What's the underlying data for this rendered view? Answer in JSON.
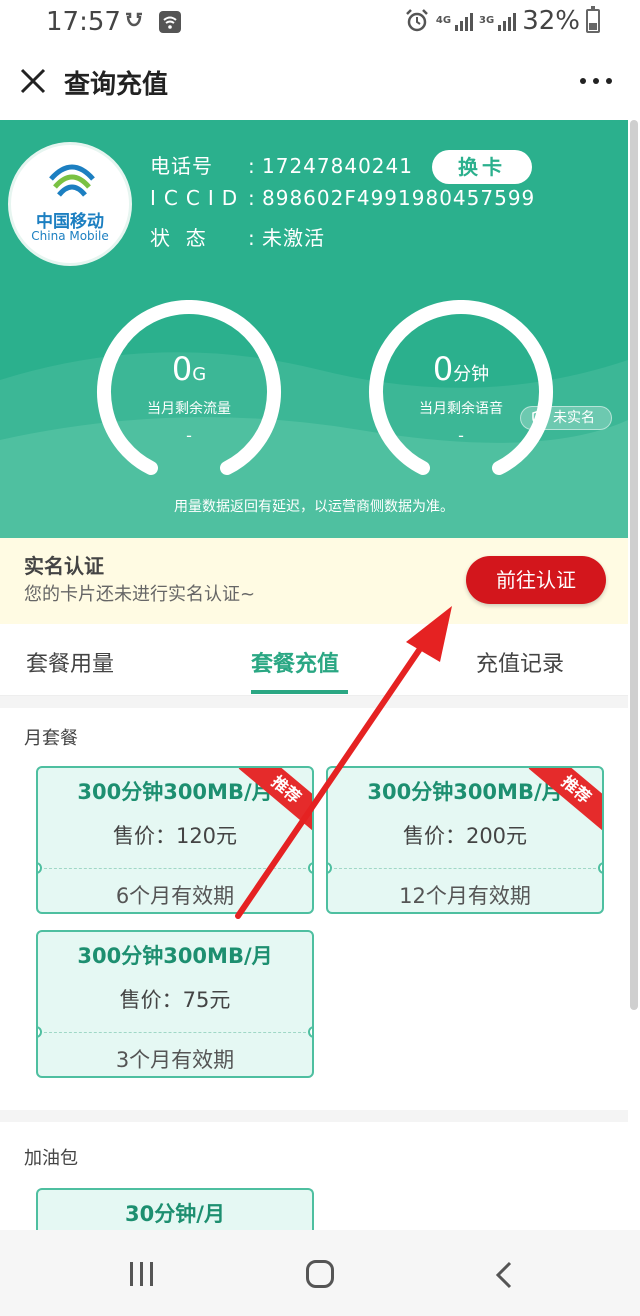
{
  "status_bar": {
    "time": "17:57",
    "battery": "32%",
    "net_4g": "4G",
    "net_3g": "3G",
    "icons": [
      "alarm-icon",
      "signal-icon",
      "battery-icon"
    ]
  },
  "title_bar": {
    "title": "查询充值",
    "close_icon": "close-icon",
    "more_icon": "more-icon"
  },
  "header": {
    "logo_cn": "中国移动",
    "logo_en": "China Mobile",
    "phone_label": "电话号",
    "phone_value": "17247840241",
    "iccid_label": "ICCID",
    "iccid_value": "898602F4991980457599",
    "status_label": "状  态",
    "status_value": "未激活",
    "separator": ":",
    "swap_button": "换卡",
    "unverified_badge": "未实名",
    "data_gauge": {
      "value": "0",
      "unit": "G",
      "label": "当月剩余流量",
      "sub": "-",
      "fraction": 0
    },
    "voice_gauge": {
      "value": "0",
      "unit": "分钟",
      "label": "当月剩余语音",
      "sub": "-",
      "fraction": 0
    },
    "note": "用量数据返回有延迟，以运营商侧数据为准。",
    "color": "#2bb08d"
  },
  "banner": {
    "title": "实名认证",
    "subtitle": "您的卡片还未进行实名认证~",
    "button": "前往认证",
    "button_color": "#d3161c"
  },
  "tabs": [
    {
      "label": "套餐用量",
      "active": false
    },
    {
      "label": "套餐充值",
      "active": true
    },
    {
      "label": "充值记录",
      "active": false
    }
  ],
  "monthly": {
    "title": "月套餐",
    "packages": [
      {
        "name": "300分钟300MB/月",
        "price": "售价：120元",
        "validity": "6个月有效期",
        "ribbon": "推荐"
      },
      {
        "name": "300分钟300MB/月",
        "price": "售价：200元",
        "validity": "12个月有效期",
        "ribbon": "推荐"
      },
      {
        "name": "300分钟300MB/月",
        "price": "售价：75元",
        "validity": "3个月有效期",
        "ribbon": ""
      }
    ]
  },
  "addon": {
    "title": "加油包",
    "packages": [
      {
        "name": "30分钟/月"
      }
    ]
  },
  "nav_bar": {
    "icons": [
      "recent-apps-icon",
      "home-icon",
      "back-icon"
    ]
  },
  "colors": {
    "accent": "#2aa783",
    "annotation_arrow": "#e52222"
  }
}
